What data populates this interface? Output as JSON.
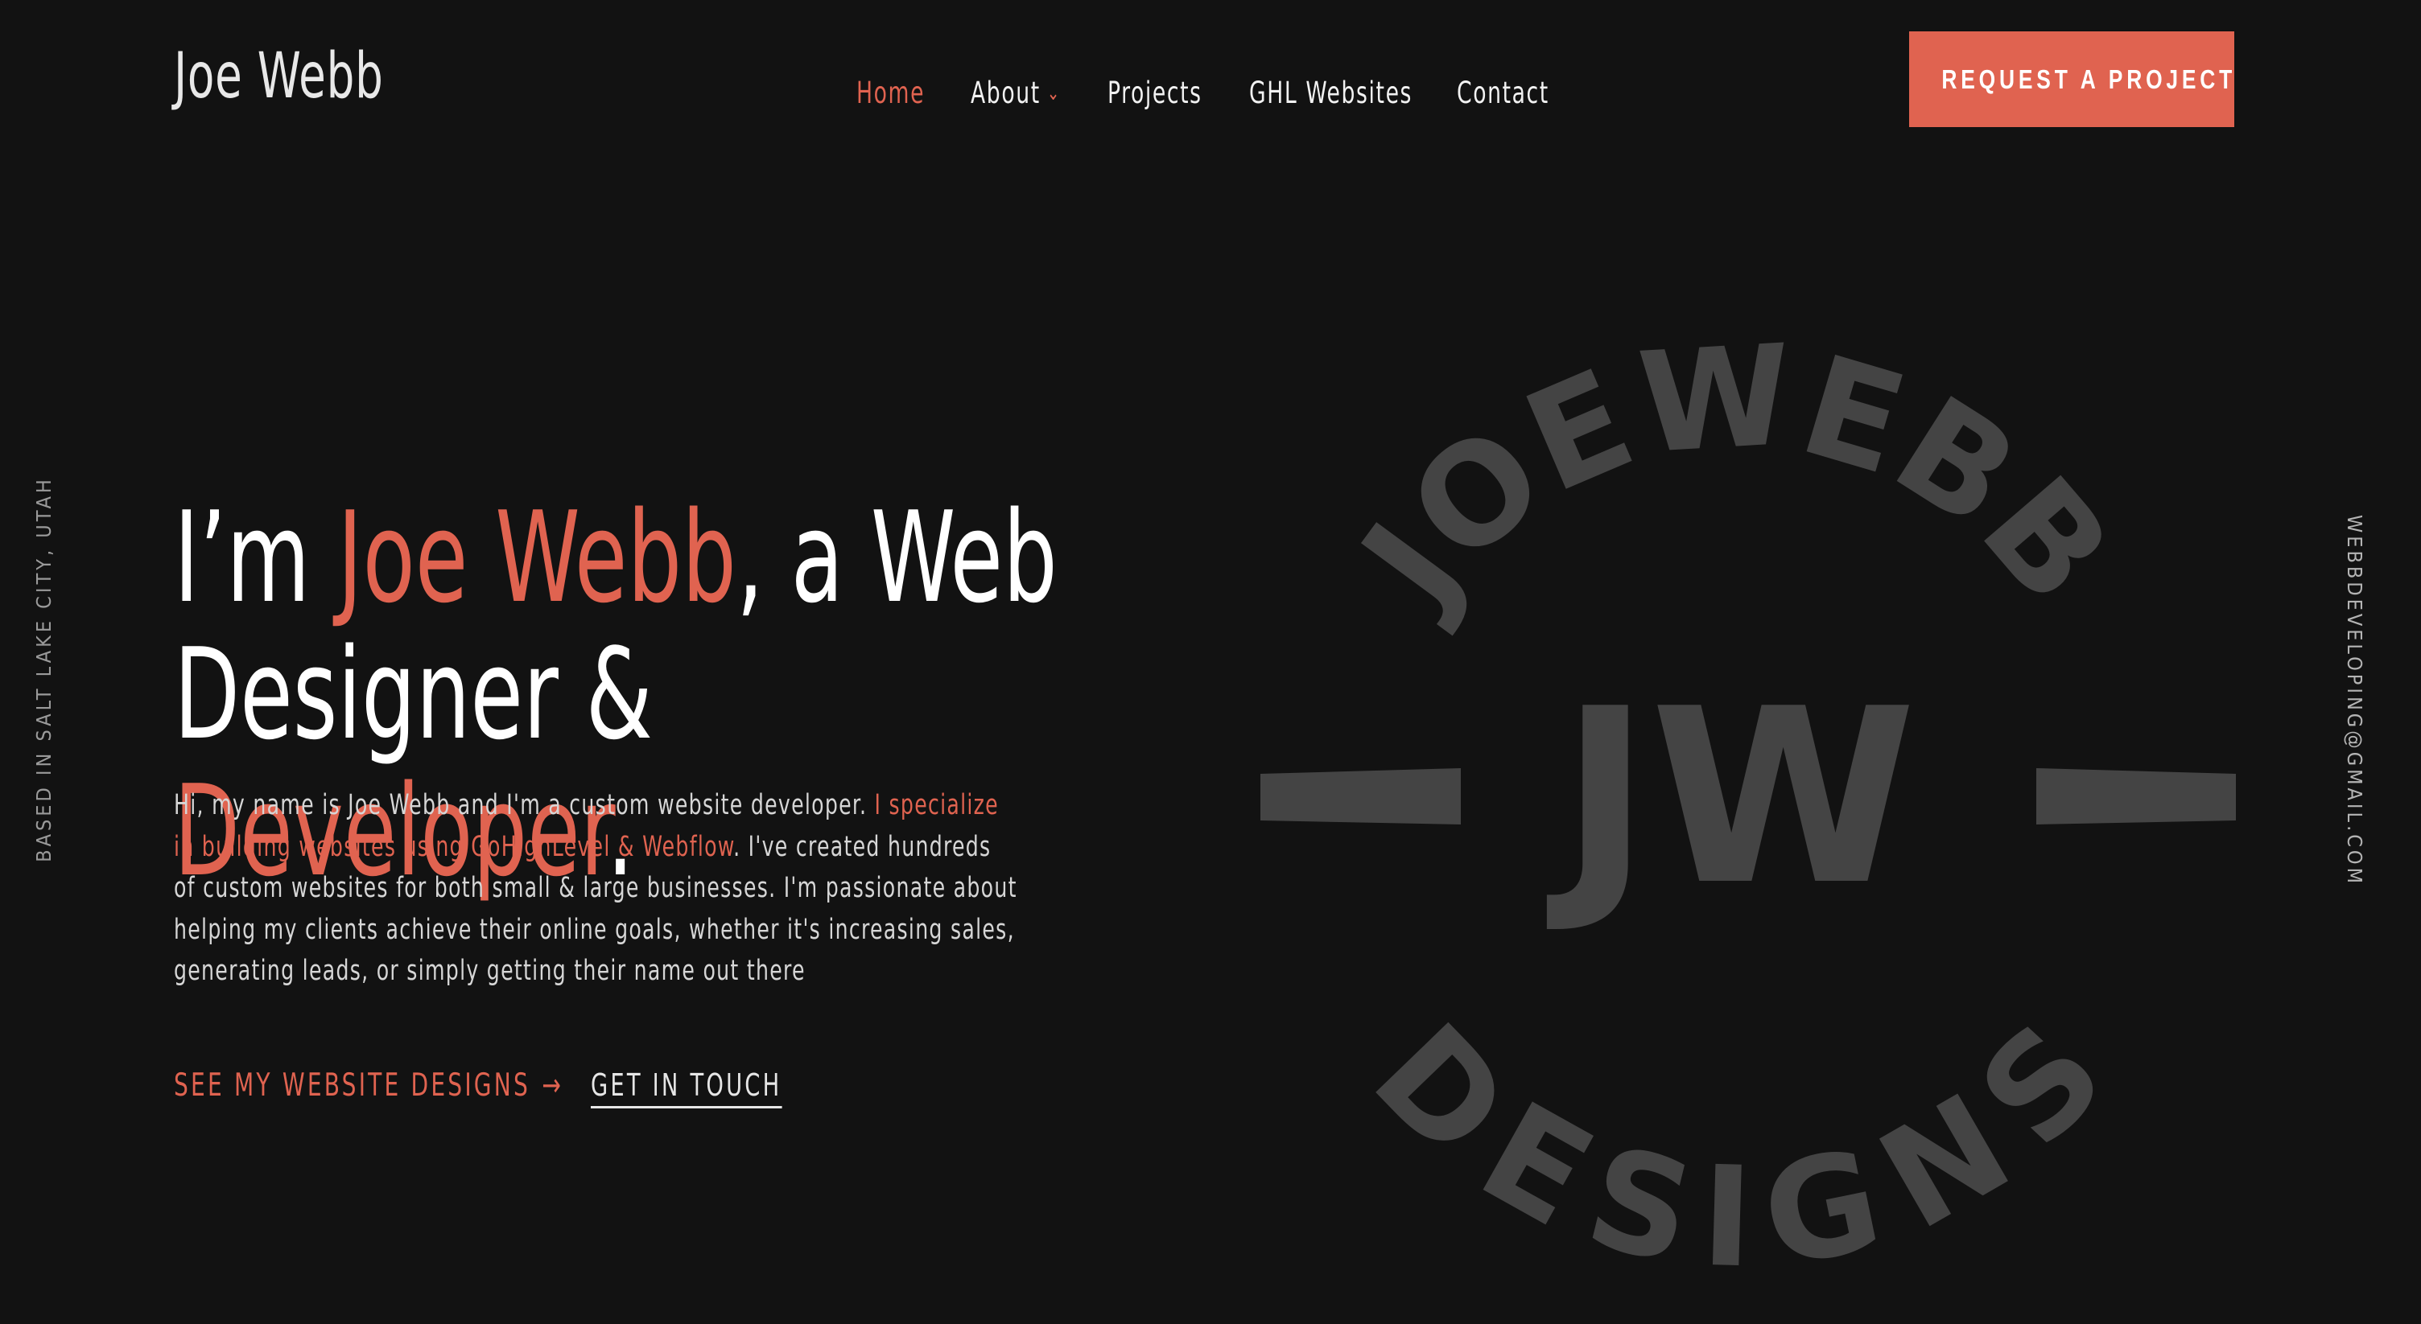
{
  "header": {
    "logo": "Joe Webb",
    "nav": [
      {
        "label": "Home",
        "active": true
      },
      {
        "label": "About",
        "has_dropdown": true
      },
      {
        "label": "Projects"
      },
      {
        "label": "GHL Websites"
      },
      {
        "label": "Contact"
      }
    ],
    "cta_label": "REQUEST A PROJECT"
  },
  "side": {
    "location": "BASED IN SALT LAKE CITY, UTAH",
    "email": "WEBBDEVELOPING@GMAIL.COM"
  },
  "hero": {
    "headline": {
      "prefix": "I’m ",
      "name": "Joe Webb",
      "middle": ", a Web Designer &",
      "role": "Developer",
      "suffix": "."
    },
    "intro": {
      "part1": "Hi, my name is Joe Webb and I'm a custom website developer. ",
      "highlight": "I specialize in building websites using GoHighLevel & Webflow",
      "part2": ". I've created hundreds of custom websites for both small & large businesses. I'm passionate about helping my clients achieve their online goals, whether it's increasing sales, generating leads, or simply getting their name out there"
    },
    "primary_link": "SEE MY WEBSITE DESIGNS",
    "primary_link_icon": "arrow-right-icon",
    "secondary_link": "GET IN TOUCH"
  },
  "emblem": {
    "monogram": "JW",
    "ring_top": "JOEWEBB",
    "ring_bottom": "DESIGNS",
    "color": "#444444"
  },
  "colors": {
    "background": "#121212",
    "accent": "#e06350",
    "text": "#ffffff"
  }
}
